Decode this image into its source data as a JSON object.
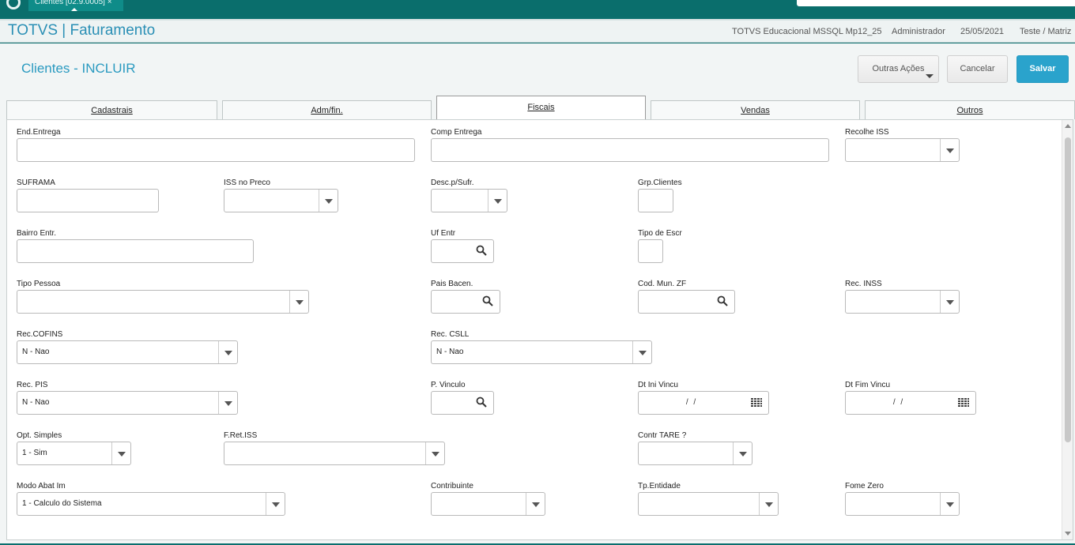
{
  "topbar": {
    "tab_label": "Clientes [02.9.0005]  ×"
  },
  "header": {
    "title": "TOTVS | Faturamento",
    "environment": "TOTVS Educacional MSSQL Mp12_25",
    "user": "Administrador",
    "date": "25/05/2021",
    "branch": "Teste / Matriz"
  },
  "page": {
    "title": "Clientes - INCLUIR",
    "buttons": {
      "other_actions": "Outras Ações",
      "cancel": "Cancelar",
      "save": "Salvar"
    }
  },
  "tabs": [
    {
      "label": "Cadastrais"
    },
    {
      "label": "Adm/fin."
    },
    {
      "label": "Fiscais"
    },
    {
      "label": "Vendas"
    },
    {
      "label": "Outros"
    }
  ],
  "active_tab": "Fiscais",
  "form": {
    "end_entrega": {
      "label": "End.Entrega",
      "value": ""
    },
    "comp_entrega": {
      "label": "Comp Entrega",
      "value": ""
    },
    "recolhe_iss": {
      "label": "Recolhe ISS",
      "value": ""
    },
    "suframa": {
      "label": "SUFRAMA",
      "value": ""
    },
    "iss_no_preco": {
      "label": "ISS no Preco",
      "value": ""
    },
    "desc_sufr": {
      "label": "Desc.p/Sufr.",
      "value": ""
    },
    "grp_clientes": {
      "label": "Grp.Clientes",
      "value": ""
    },
    "bairro_entr": {
      "label": "Bairro Entr.",
      "value": ""
    },
    "uf_entr": {
      "label": "Uf Entr",
      "value": ""
    },
    "tipo_escr": {
      "label": "Tipo de Escr",
      "value": ""
    },
    "tipo_pessoa": {
      "label": "Tipo Pessoa",
      "value": ""
    },
    "pais_bacen": {
      "label": "Pais Bacen.",
      "value": ""
    },
    "cod_mun_zf": {
      "label": "Cod. Mun. ZF",
      "value": ""
    },
    "rec_inss": {
      "label": "Rec. INSS",
      "value": ""
    },
    "rec_cofins": {
      "label": "Rec.COFINS",
      "value": "N - Nao"
    },
    "rec_csll": {
      "label": "Rec. CSLL",
      "value": "N - Nao"
    },
    "rec_pis": {
      "label": "Rec. PIS",
      "value": "N - Nao"
    },
    "p_vinculo": {
      "label": "P. Vinculo",
      "value": ""
    },
    "dt_ini_vincu": {
      "label": "Dt Ini Vincu",
      "value": "/ /"
    },
    "dt_fim_vincu": {
      "label": "Dt Fim Vincu",
      "value": "/ /"
    },
    "opt_simples": {
      "label": "Opt. Simples",
      "value": "1 - Sim"
    },
    "f_ret_iss": {
      "label": "F.Ret.ISS",
      "value": ""
    },
    "contr_tare": {
      "label": "Contr TARE ?",
      "value": ""
    },
    "modo_abat": {
      "label": "Modo Abat Im",
      "value": "1 - Calculo do Sistema"
    },
    "contribuinte": {
      "label": "Contribuinte",
      "value": ""
    },
    "tp_entidade": {
      "label": "Tp.Entidade",
      "value": ""
    },
    "fome_zero": {
      "label": "Fome Zero",
      "value": ""
    }
  },
  "colors": {
    "accent": "#2a9ac0",
    "primary_button": "#2aa3cc",
    "frame": "#0a6e6c"
  }
}
